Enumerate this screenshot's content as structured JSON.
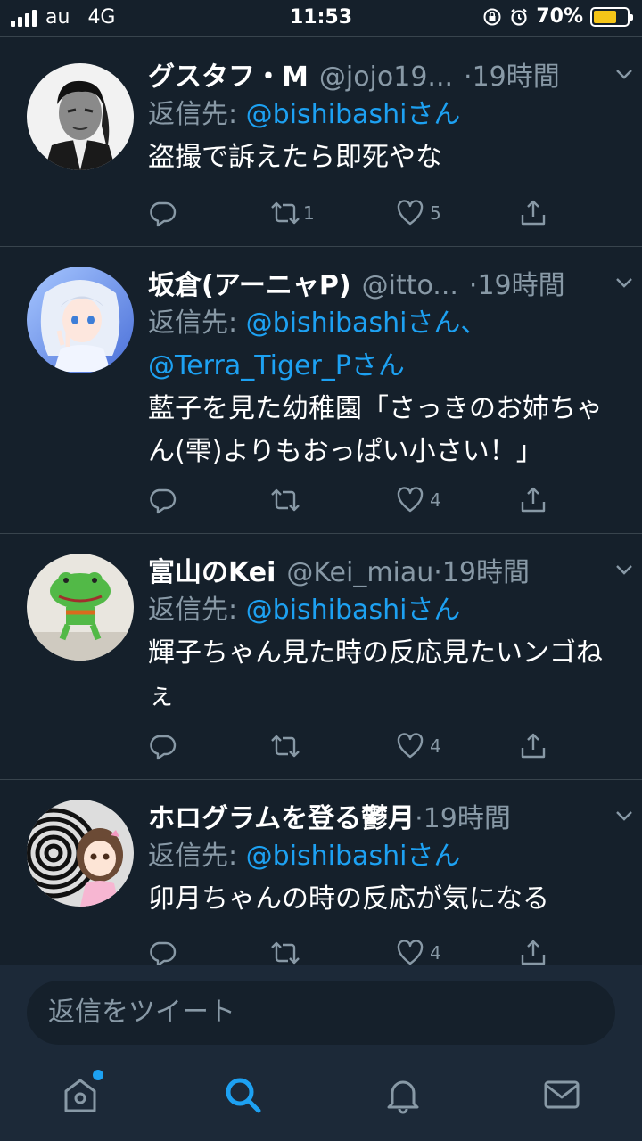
{
  "status_bar": {
    "carrier": "au",
    "network": "4G",
    "time": "11:53",
    "battery_percent": "70%",
    "battery_level": 0.7
  },
  "tweets": [
    {
      "display_name": "グスタフ・M",
      "handle": "@jojo19...",
      "time": "·19時間",
      "reply_label": "返信先: ",
      "reply_mentions": "@bishibashiさん",
      "reply_mentions_2": "",
      "text": "盗撮で訴えたら即死やな",
      "retweets": "1",
      "likes": "5",
      "avatar_icon": "avatar-man-grayscale"
    },
    {
      "display_name": "坂倉(アーニャP)",
      "handle": "@itto...",
      "time": "·19時間",
      "reply_label": "返信先: ",
      "reply_mentions": "@bishibashiさん、",
      "reply_mentions_2": "@Terra_Tiger_Pさん",
      "text": "藍子を見た幼稚園「さっきのお姉ちゃん(雫)よりもおっぱい小さい！」",
      "retweets": "",
      "likes": "4",
      "avatar_icon": "avatar-anime-silver-hair"
    },
    {
      "display_name": "富山のKei",
      "handle": "@Kei_miau",
      "time": "·19時間",
      "reply_label": "返信先: ",
      "reply_mentions": "@bishibashiさん",
      "reply_mentions_2": "",
      "text": "輝子ちゃん見た時の反応見たいンゴねぇ",
      "retweets": "",
      "likes": "4",
      "avatar_icon": "avatar-green-frog-drawing"
    },
    {
      "display_name": "ホログラムを登る鬱月",
      "handle": "",
      "time": "·19時間",
      "reply_label": "返信先: ",
      "reply_mentions": "@bishibashiさん",
      "reply_mentions_2": "",
      "text": "卯月ちゃんの時の反応が気になる",
      "retweets": "",
      "likes": "4",
      "avatar_icon": "avatar-hypnotic-anime-girl"
    }
  ],
  "reply_box": {
    "placeholder": "返信をツイート"
  },
  "tab_bar": {
    "items": [
      "home-icon",
      "search-icon",
      "notifications-icon",
      "messages-icon"
    ],
    "active": "search-icon"
  },
  "colors": {
    "background": "#15202b",
    "bar_background": "#1c2938",
    "accent": "#1da1f2",
    "secondary_text": "#8899a6",
    "divider": "#38444d",
    "battery": "#f5c518"
  }
}
